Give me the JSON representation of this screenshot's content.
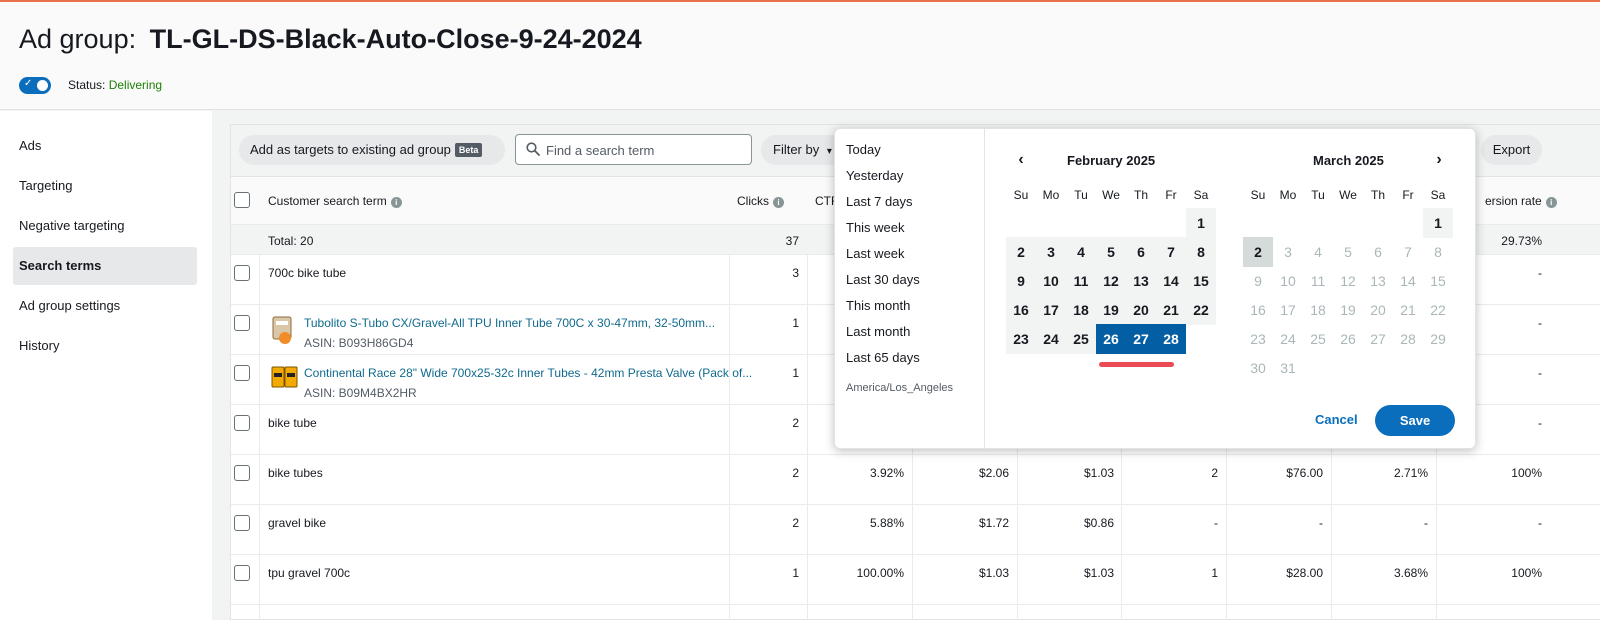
{
  "header": {
    "title_prefix": "Ad group:",
    "title_name": "TL-GL-DS-Black-Auto-Close-9-24-2024",
    "status_label": "Status:",
    "status_value": "Delivering"
  },
  "sidenav": {
    "items": [
      "Ads",
      "Targeting",
      "Negative targeting",
      "Search terms",
      "Ad group settings",
      "History"
    ],
    "active": "Search terms"
  },
  "toolbar": {
    "add_targets_label": "Add as targets to existing ad group",
    "beta_badge": "Beta",
    "search_placeholder": "Find a search term",
    "filter_label": "Filter by",
    "export_label": "Export"
  },
  "table": {
    "headers": {
      "search_term": "Customer search term",
      "clicks": "Clicks",
      "ctr": "CTR",
      "conv_rate": "ersion rate"
    },
    "total": {
      "label": "Total: 20",
      "clicks": "37",
      "conv_rate": "29.73%"
    },
    "rows": [
      {
        "term": "700c bike tube",
        "clicks": "3",
        "ctr": "",
        "cpc": "",
        "spend": "",
        "orders": "",
        "sales": "",
        "acos": "",
        "conv": "-"
      },
      {
        "term": "Tubolito S-Tubo CX/Gravel-All TPU Inner Tube 700C x 30-47mm, 32-50mm...",
        "asin": "ASIN: B093H86GD4",
        "clicks": "1",
        "ctr": "",
        "cpc": "",
        "spend": "",
        "orders": "",
        "sales": "",
        "acos": "",
        "conv": "-"
      },
      {
        "term": "Continental Race 28\" Wide 700x25-32c Inner Tubes - 42mm Presta Valve (Pack of...",
        "asin": "ASIN: B09M4BX2HR",
        "clicks": "1",
        "ctr": "",
        "cpc": "",
        "spend": "",
        "orders": "",
        "sales": "",
        "acos": "",
        "conv": "-"
      },
      {
        "term": "bike tube",
        "clicks": "2",
        "ctr": "",
        "cpc": "",
        "spend": "",
        "orders": "",
        "sales": "",
        "acos": "",
        "conv": "-"
      },
      {
        "term": "bike tubes",
        "clicks": "2",
        "ctr": "3.92%",
        "cpc": "$2.06",
        "spend": "$1.03",
        "orders": "2",
        "sales": "$76.00",
        "acos": "2.71%",
        "conv": "100%"
      },
      {
        "term": "gravel bike",
        "clicks": "2",
        "ctr": "5.88%",
        "cpc": "$1.72",
        "spend": "$0.86",
        "orders": "-",
        "sales": "-",
        "acos": "-",
        "conv": "-"
      },
      {
        "term": "tpu gravel 700c",
        "clicks": "1",
        "ctr": "100.00%",
        "cpc": "$1.03",
        "spend": "$1.03",
        "orders": "1",
        "sales": "$28.00",
        "acos": "3.68%",
        "conv": "100%"
      }
    ]
  },
  "datepicker": {
    "presets": [
      "Today",
      "Yesterday",
      "Last 7 days",
      "This week",
      "Last week",
      "Last 30 days",
      "This month",
      "Last month",
      "Last 65 days"
    ],
    "timezone": "America/Los_Angeles",
    "weekdays": [
      "Su",
      "Mo",
      "Tu",
      "We",
      "Th",
      "Fr",
      "Sa"
    ],
    "left_month": "February 2025",
    "right_month": "March 2025",
    "prev_icon": "‹",
    "next_icon": "›",
    "selected_range": [
      26,
      27,
      28
    ],
    "cancel_label": "Cancel",
    "save_label": "Save"
  },
  "colors": {
    "accent": "#0a6ebd",
    "selected_day": "#045ea3",
    "status_green": "#1d8102",
    "link": "#0f6a8e",
    "highlight_underline": "#ec4a55"
  }
}
